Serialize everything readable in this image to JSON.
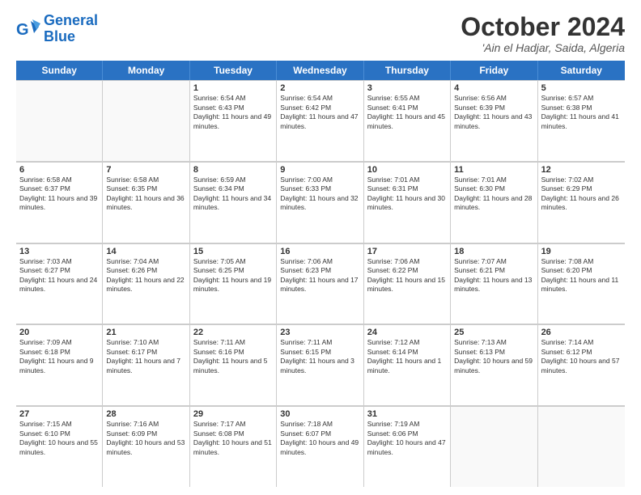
{
  "header": {
    "logo_line1": "General",
    "logo_line2": "Blue",
    "month_title": "October 2024",
    "location": "'Ain el Hadjar, Saida, Algeria"
  },
  "weekdays": [
    "Sunday",
    "Monday",
    "Tuesday",
    "Wednesday",
    "Thursday",
    "Friday",
    "Saturday"
  ],
  "rows": [
    [
      {
        "day": "",
        "sunrise": "",
        "sunset": "",
        "daylight": ""
      },
      {
        "day": "",
        "sunrise": "",
        "sunset": "",
        "daylight": ""
      },
      {
        "day": "1",
        "sunrise": "Sunrise: 6:54 AM",
        "sunset": "Sunset: 6:43 PM",
        "daylight": "Daylight: 11 hours and 49 minutes."
      },
      {
        "day": "2",
        "sunrise": "Sunrise: 6:54 AM",
        "sunset": "Sunset: 6:42 PM",
        "daylight": "Daylight: 11 hours and 47 minutes."
      },
      {
        "day": "3",
        "sunrise": "Sunrise: 6:55 AM",
        "sunset": "Sunset: 6:41 PM",
        "daylight": "Daylight: 11 hours and 45 minutes."
      },
      {
        "day": "4",
        "sunrise": "Sunrise: 6:56 AM",
        "sunset": "Sunset: 6:39 PM",
        "daylight": "Daylight: 11 hours and 43 minutes."
      },
      {
        "day": "5",
        "sunrise": "Sunrise: 6:57 AM",
        "sunset": "Sunset: 6:38 PM",
        "daylight": "Daylight: 11 hours and 41 minutes."
      }
    ],
    [
      {
        "day": "6",
        "sunrise": "Sunrise: 6:58 AM",
        "sunset": "Sunset: 6:37 PM",
        "daylight": "Daylight: 11 hours and 39 minutes."
      },
      {
        "day": "7",
        "sunrise": "Sunrise: 6:58 AM",
        "sunset": "Sunset: 6:35 PM",
        "daylight": "Daylight: 11 hours and 36 minutes."
      },
      {
        "day": "8",
        "sunrise": "Sunrise: 6:59 AM",
        "sunset": "Sunset: 6:34 PM",
        "daylight": "Daylight: 11 hours and 34 minutes."
      },
      {
        "day": "9",
        "sunrise": "Sunrise: 7:00 AM",
        "sunset": "Sunset: 6:33 PM",
        "daylight": "Daylight: 11 hours and 32 minutes."
      },
      {
        "day": "10",
        "sunrise": "Sunrise: 7:01 AM",
        "sunset": "Sunset: 6:31 PM",
        "daylight": "Daylight: 11 hours and 30 minutes."
      },
      {
        "day": "11",
        "sunrise": "Sunrise: 7:01 AM",
        "sunset": "Sunset: 6:30 PM",
        "daylight": "Daylight: 11 hours and 28 minutes."
      },
      {
        "day": "12",
        "sunrise": "Sunrise: 7:02 AM",
        "sunset": "Sunset: 6:29 PM",
        "daylight": "Daylight: 11 hours and 26 minutes."
      }
    ],
    [
      {
        "day": "13",
        "sunrise": "Sunrise: 7:03 AM",
        "sunset": "Sunset: 6:27 PM",
        "daylight": "Daylight: 11 hours and 24 minutes."
      },
      {
        "day": "14",
        "sunrise": "Sunrise: 7:04 AM",
        "sunset": "Sunset: 6:26 PM",
        "daylight": "Daylight: 11 hours and 22 minutes."
      },
      {
        "day": "15",
        "sunrise": "Sunrise: 7:05 AM",
        "sunset": "Sunset: 6:25 PM",
        "daylight": "Daylight: 11 hours and 19 minutes."
      },
      {
        "day": "16",
        "sunrise": "Sunrise: 7:06 AM",
        "sunset": "Sunset: 6:23 PM",
        "daylight": "Daylight: 11 hours and 17 minutes."
      },
      {
        "day": "17",
        "sunrise": "Sunrise: 7:06 AM",
        "sunset": "Sunset: 6:22 PM",
        "daylight": "Daylight: 11 hours and 15 minutes."
      },
      {
        "day": "18",
        "sunrise": "Sunrise: 7:07 AM",
        "sunset": "Sunset: 6:21 PM",
        "daylight": "Daylight: 11 hours and 13 minutes."
      },
      {
        "day": "19",
        "sunrise": "Sunrise: 7:08 AM",
        "sunset": "Sunset: 6:20 PM",
        "daylight": "Daylight: 11 hours and 11 minutes."
      }
    ],
    [
      {
        "day": "20",
        "sunrise": "Sunrise: 7:09 AM",
        "sunset": "Sunset: 6:18 PM",
        "daylight": "Daylight: 11 hours and 9 minutes."
      },
      {
        "day": "21",
        "sunrise": "Sunrise: 7:10 AM",
        "sunset": "Sunset: 6:17 PM",
        "daylight": "Daylight: 11 hours and 7 minutes."
      },
      {
        "day": "22",
        "sunrise": "Sunrise: 7:11 AM",
        "sunset": "Sunset: 6:16 PM",
        "daylight": "Daylight: 11 hours and 5 minutes."
      },
      {
        "day": "23",
        "sunrise": "Sunrise: 7:11 AM",
        "sunset": "Sunset: 6:15 PM",
        "daylight": "Daylight: 11 hours and 3 minutes."
      },
      {
        "day": "24",
        "sunrise": "Sunrise: 7:12 AM",
        "sunset": "Sunset: 6:14 PM",
        "daylight": "Daylight: 11 hours and 1 minute."
      },
      {
        "day": "25",
        "sunrise": "Sunrise: 7:13 AM",
        "sunset": "Sunset: 6:13 PM",
        "daylight": "Daylight: 10 hours and 59 minutes."
      },
      {
        "day": "26",
        "sunrise": "Sunrise: 7:14 AM",
        "sunset": "Sunset: 6:12 PM",
        "daylight": "Daylight: 10 hours and 57 minutes."
      }
    ],
    [
      {
        "day": "27",
        "sunrise": "Sunrise: 7:15 AM",
        "sunset": "Sunset: 6:10 PM",
        "daylight": "Daylight: 10 hours and 55 minutes."
      },
      {
        "day": "28",
        "sunrise": "Sunrise: 7:16 AM",
        "sunset": "Sunset: 6:09 PM",
        "daylight": "Daylight: 10 hours and 53 minutes."
      },
      {
        "day": "29",
        "sunrise": "Sunrise: 7:17 AM",
        "sunset": "Sunset: 6:08 PM",
        "daylight": "Daylight: 10 hours and 51 minutes."
      },
      {
        "day": "30",
        "sunrise": "Sunrise: 7:18 AM",
        "sunset": "Sunset: 6:07 PM",
        "daylight": "Daylight: 10 hours and 49 minutes."
      },
      {
        "day": "31",
        "sunrise": "Sunrise: 7:19 AM",
        "sunset": "Sunset: 6:06 PM",
        "daylight": "Daylight: 10 hours and 47 minutes."
      },
      {
        "day": "",
        "sunrise": "",
        "sunset": "",
        "daylight": ""
      },
      {
        "day": "",
        "sunrise": "",
        "sunset": "",
        "daylight": ""
      }
    ]
  ]
}
